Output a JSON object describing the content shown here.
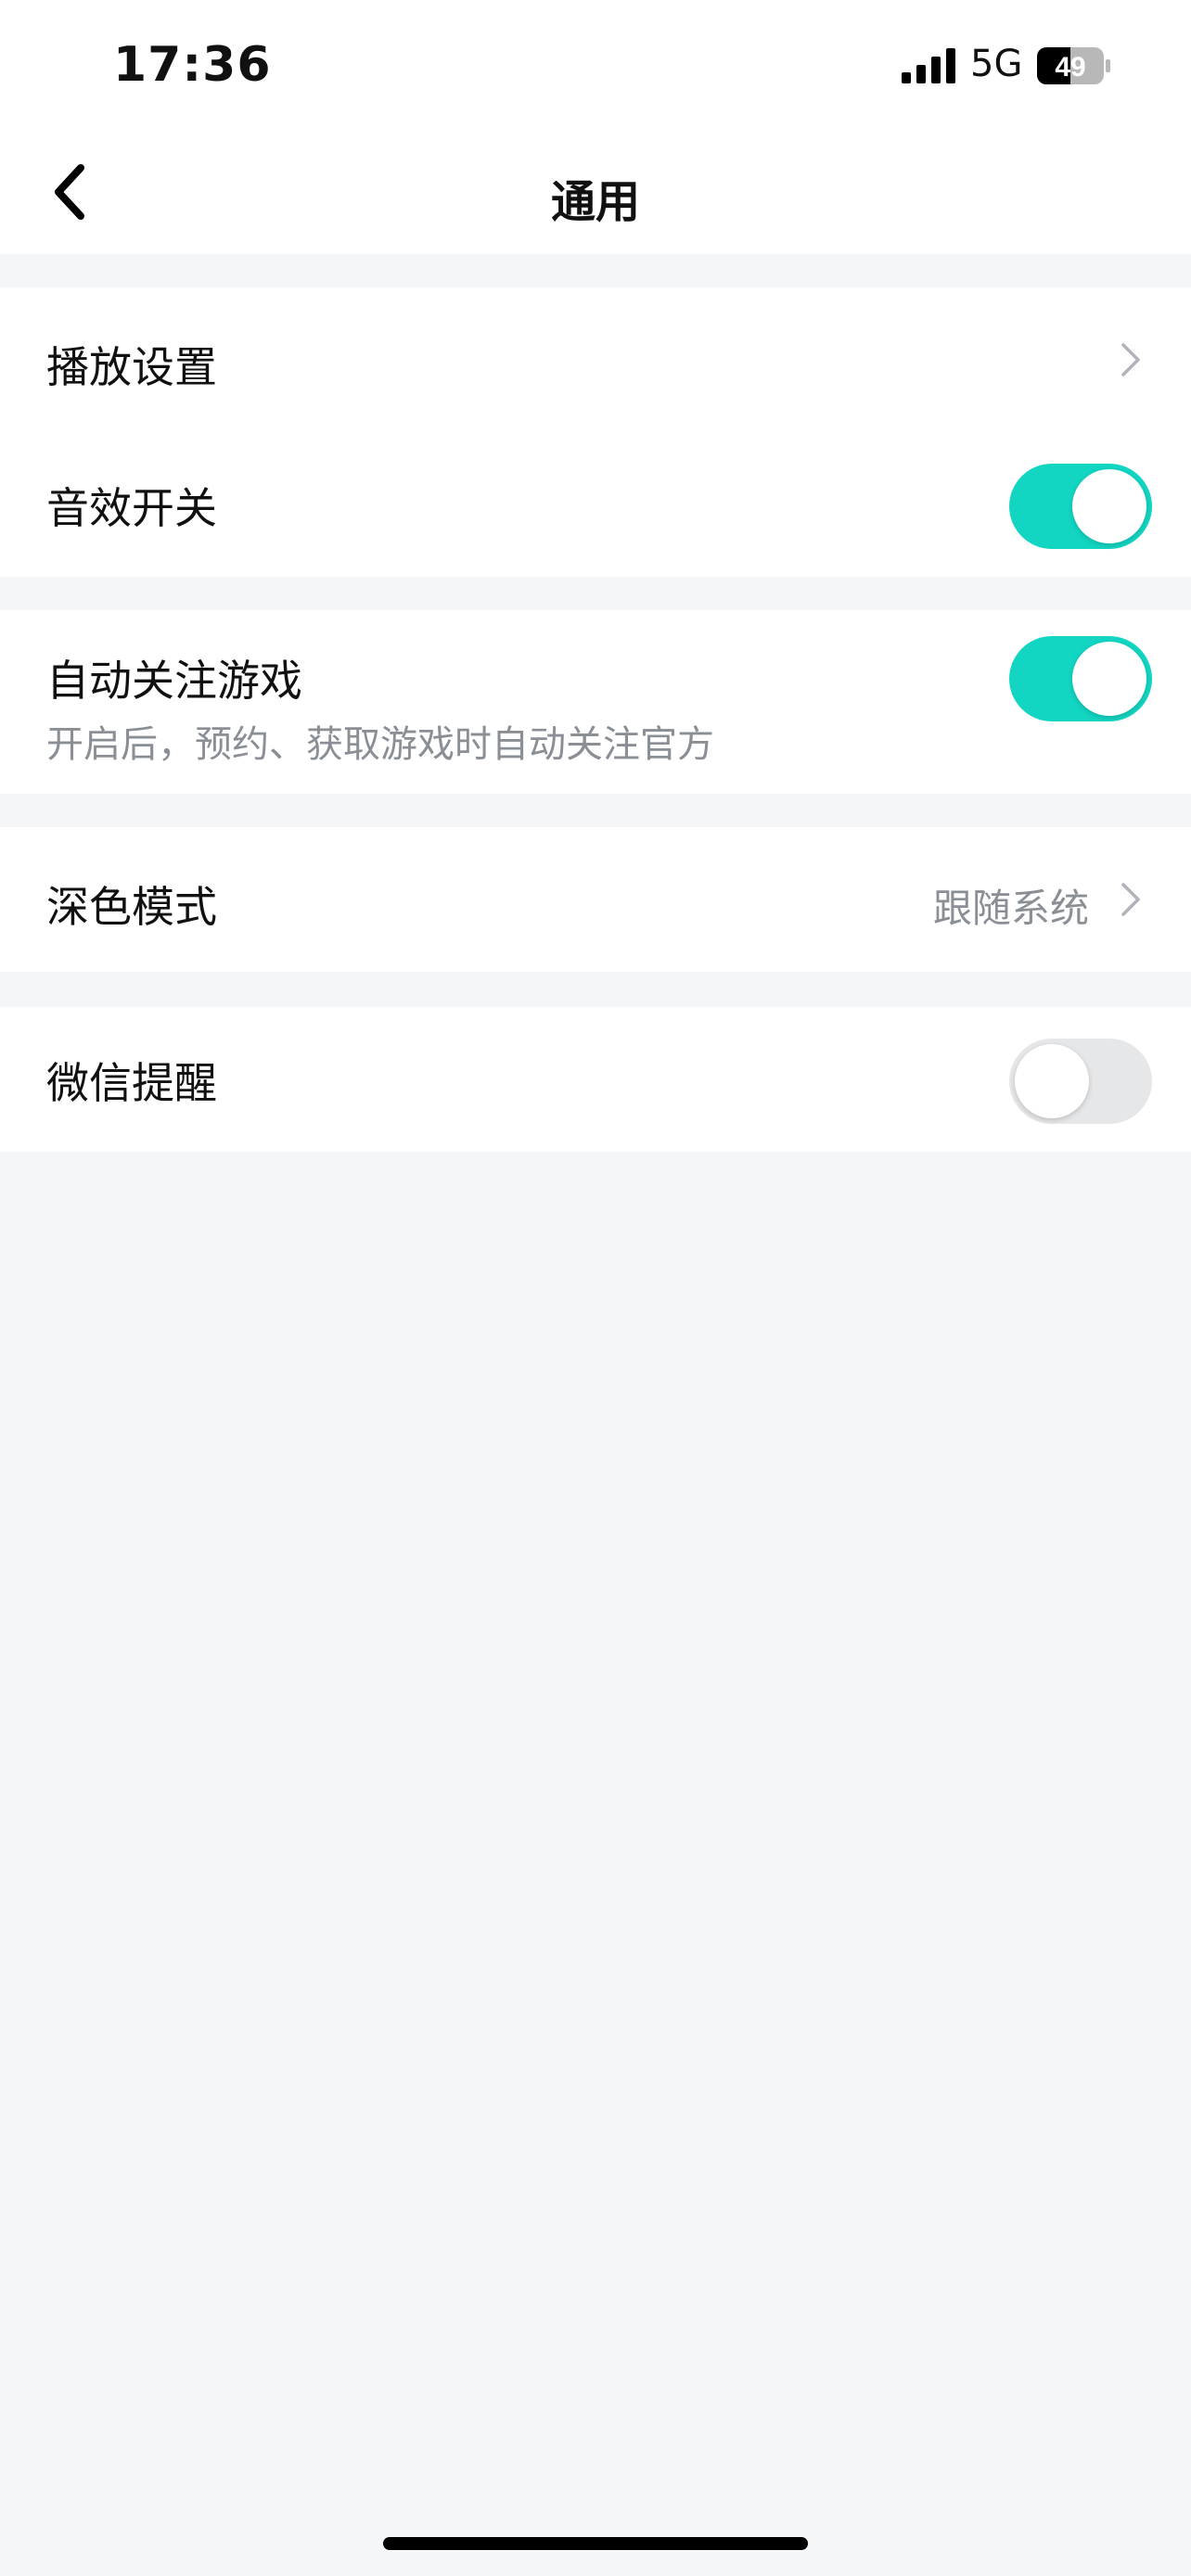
{
  "status_bar": {
    "time": "17:36",
    "network": "5G",
    "battery": "49"
  },
  "nav": {
    "title": "通用",
    "back_icon": "chevron-left-icon"
  },
  "settings": {
    "playback": {
      "label": "播放设置",
      "icon": "chevron-right-icon"
    },
    "sound_effects": {
      "label": "音效开关",
      "enabled": true
    },
    "auto_follow": {
      "label": "自动关注游戏",
      "description": "开启后，预约、获取游戏时自动关注官方",
      "enabled": true
    },
    "dark_mode": {
      "label": "深色模式",
      "value": "跟随系统",
      "icon": "chevron-right-icon"
    },
    "wechat_reminder": {
      "label": "微信提醒",
      "enabled": false
    }
  },
  "colors": {
    "accent": "#12d6c2",
    "background": "#f5f6f8",
    "secondary_text": "#8a8f96"
  }
}
